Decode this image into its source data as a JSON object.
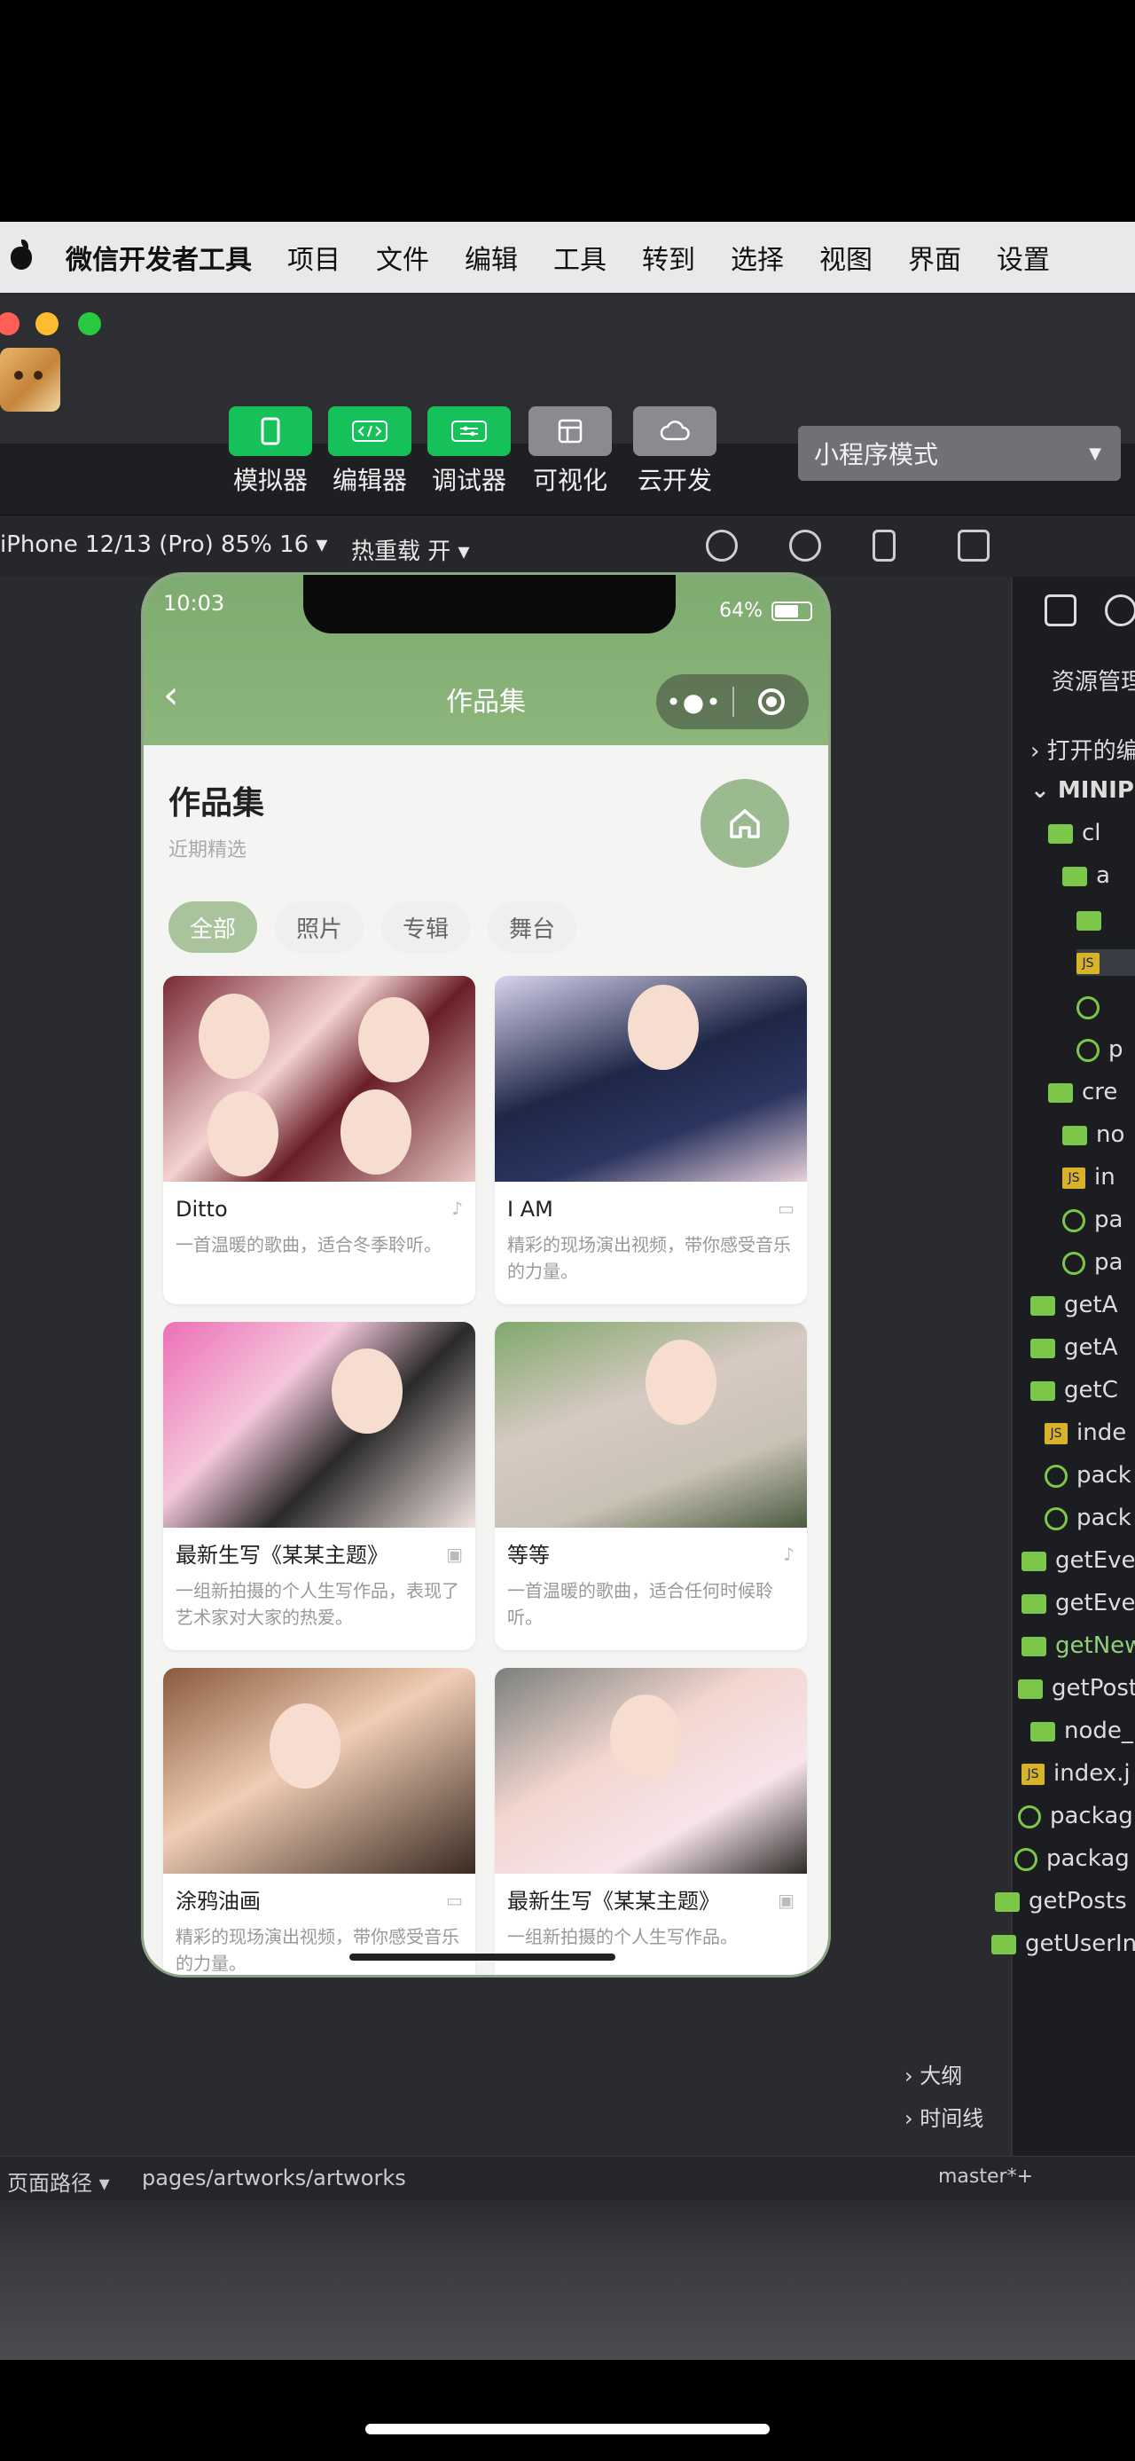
{
  "menubar": {
    "app_name": "微信开发者工具",
    "items": [
      "项目",
      "文件",
      "编辑",
      "工具",
      "转到",
      "选择",
      "视图",
      "界面",
      "设置"
    ]
  },
  "toolbar": {
    "tools": [
      {
        "label": "模拟器",
        "icon": "phone-icon",
        "style": "green"
      },
      {
        "label": "编辑器",
        "icon": "code-icon",
        "style": "green"
      },
      {
        "label": "调试器",
        "icon": "sliders-icon",
        "style": "green"
      },
      {
        "label": "可视化",
        "icon": "layout-icon",
        "style": "grey"
      },
      {
        "label": "云开发",
        "icon": "cloud-icon",
        "style": "grey"
      }
    ],
    "mode": "小程序模式"
  },
  "devicebar": {
    "device": "iPhone 12/13 (Pro) 85% 16 ▾",
    "hot_reload": "热重载 开 ▾"
  },
  "phone": {
    "time": "10:03",
    "battery": "64%",
    "nav_title": "作品集",
    "page_title": "作品集",
    "page_subtitle": "近期精选",
    "filters": [
      "全部",
      "照片",
      "专辑",
      "舞台"
    ],
    "active_filter": 0,
    "cards": [
      {
        "name": "Ditto",
        "desc": "一首温暖的歌曲，适合冬季聆听。",
        "type": "music-icon"
      },
      {
        "name": "I AM",
        "desc": "精彩的现场演出视频，带你感受音乐的力量。",
        "type": "video-icon"
      },
      {
        "name": "最新生写《某某主题》",
        "desc": "一组新拍摄的个人生写作品，表现了艺术家对大家的热爱。",
        "type": "image-icon"
      },
      {
        "name": "等等",
        "desc": "一首温暖的歌曲，适合任何时候聆听。",
        "type": "music-icon"
      },
      {
        "name": "涂鸦油画",
        "desc": "精彩的现场演出视频，带你感受音乐的力量。",
        "type": "video-icon"
      },
      {
        "name": "最新生写《某某主题》",
        "desc": "一组新拍摄的个人生写作品。",
        "type": "image-icon"
      }
    ]
  },
  "explorer": {
    "title": "资源管理",
    "open_editors": "打开的编",
    "project": "MINIPRO",
    "rows": [
      "cl",
      "a",
      "",
      "",
      "",
      "p",
      "cre",
      "no",
      "in",
      "pa",
      "pa",
      "getA",
      "getA",
      "getC",
      "inde",
      "pack",
      "pack",
      "getEve",
      "getEve",
      "getNew",
      "getPost",
      "node_",
      "index.j",
      "packag",
      "packag",
      "getPosts",
      "getUserIn"
    ],
    "outline": "大纲",
    "timeline": "时间线"
  },
  "statusbar": {
    "path_label": "页面路径 ▾",
    "path": "pages/artworks/artworks",
    "branch": "master*+"
  }
}
